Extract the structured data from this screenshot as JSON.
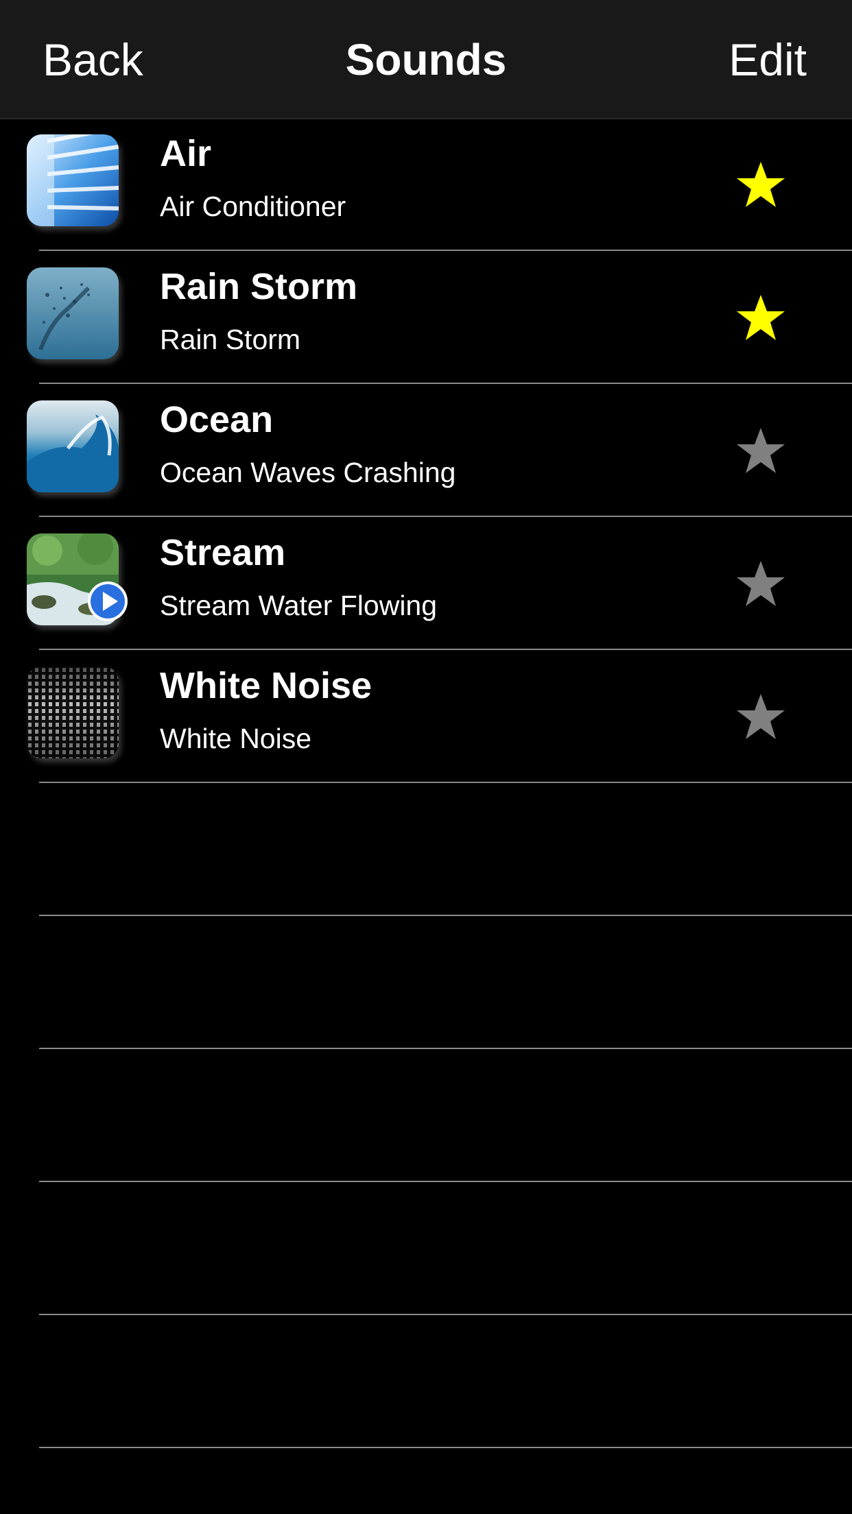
{
  "navbar": {
    "back_label": "Back",
    "title": "Sounds",
    "edit_label": "Edit"
  },
  "colors": {
    "background": "#000000",
    "navbar": "#191919",
    "separator": "#8a8a8a",
    "star_favorite": "#ffff00",
    "star_normal": "#808080",
    "play_badge": "#2a6fe0"
  },
  "sounds": [
    {
      "title": "Air",
      "subtitle": "Air Conditioner",
      "icon": "air-conditioner-thumbnail",
      "favorite": true,
      "playing": false
    },
    {
      "title": "Rain Storm",
      "subtitle": "Rain Storm",
      "icon": "rain-storm-thumbnail",
      "favorite": true,
      "playing": false
    },
    {
      "title": "Ocean",
      "subtitle": "Ocean Waves Crashing",
      "icon": "ocean-wave-thumbnail",
      "favorite": false,
      "playing": false
    },
    {
      "title": "Stream",
      "subtitle": "Stream Water Flowing",
      "icon": "stream-thumbnail",
      "favorite": false,
      "playing": true
    },
    {
      "title": "White Noise",
      "subtitle": "White Noise",
      "icon": "white-noise-thumbnail",
      "favorite": false,
      "playing": false
    }
  ]
}
